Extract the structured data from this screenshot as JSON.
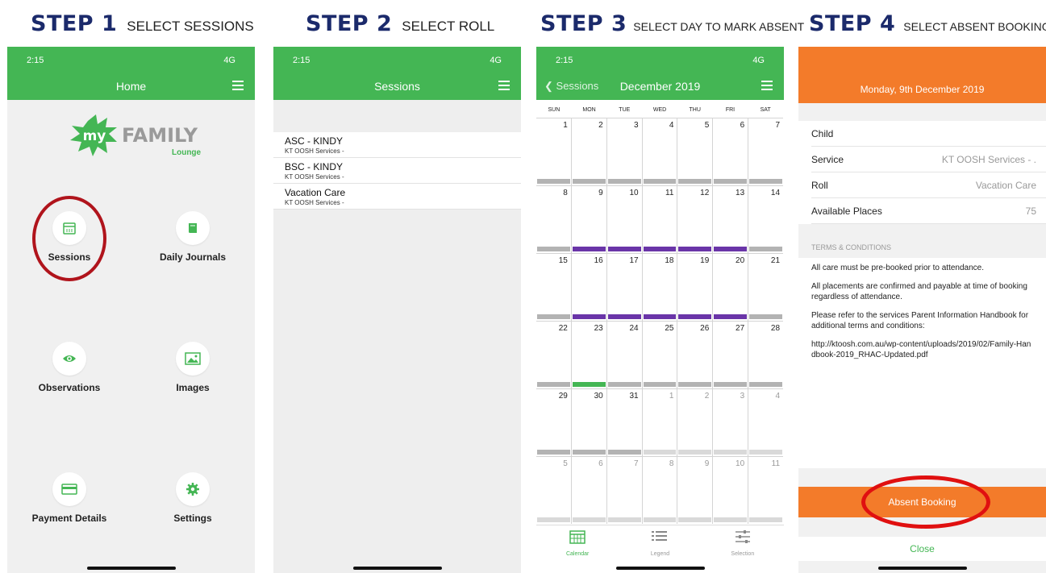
{
  "steps": [
    {
      "big": "STEP 1",
      "small": "SELECT SESSIONS"
    },
    {
      "big": "STEP 2",
      "small": "SELECT ROLL"
    },
    {
      "big": "STEP 3",
      "small": "SELECT DAY TO MARK ABSENT"
    },
    {
      "big": "STEP 4",
      "small": "SELECT ABSENT BOOKING"
    }
  ],
  "status": {
    "time": "2:15",
    "signal": "4G"
  },
  "home": {
    "title": "Home",
    "logo_my": "my",
    "logo_family": "FAMILY",
    "logo_lounge": "Lounge",
    "tiles": [
      {
        "label": "Sessions",
        "icon": "calendar-icon"
      },
      {
        "label": "Daily Journals",
        "icon": "book-icon"
      },
      {
        "label": "Observations",
        "icon": "eye-icon"
      },
      {
        "label": "Images",
        "icon": "image-icon"
      },
      {
        "label": "Payment Details",
        "icon": "card-icon"
      },
      {
        "label": "Settings",
        "icon": "gear-icon"
      }
    ]
  },
  "sessions": {
    "title": "Sessions",
    "items": [
      {
        "name": "ASC - KINDY",
        "sub": "KT OOSH Services -"
      },
      {
        "name": "BSC - KINDY",
        "sub": "KT OOSH Services -"
      },
      {
        "name": "Vacation Care",
        "sub": "KT OOSH Services -"
      }
    ]
  },
  "calendar": {
    "back": "Sessions",
    "month": "December 2019",
    "dow": [
      "SUN",
      "MON",
      "TUE",
      "WED",
      "THU",
      "FRI",
      "SAT"
    ],
    "weeks": [
      {
        "days": [
          "1",
          "2",
          "3",
          "4",
          "5",
          "6",
          "7"
        ],
        "bars": [
          "g",
          "g",
          "g",
          "g",
          "g",
          "g",
          "g"
        ]
      },
      {
        "days": [
          "8",
          "9",
          "10",
          "11",
          "12",
          "13",
          "14"
        ],
        "bars": [
          "g",
          "p",
          "p",
          "p",
          "p",
          "p",
          "g"
        ]
      },
      {
        "days": [
          "15",
          "16",
          "17",
          "18",
          "19",
          "20",
          "21"
        ],
        "bars": [
          "g",
          "p",
          "p",
          "p",
          "p",
          "p",
          "g"
        ]
      },
      {
        "days": [
          "22",
          "23",
          "24",
          "25",
          "26",
          "27",
          "28"
        ],
        "bars": [
          "g",
          "G",
          "g",
          "g",
          "g",
          "g",
          "g"
        ]
      },
      {
        "days": [
          "29",
          "30",
          "31",
          "1",
          "2",
          "3",
          "4"
        ],
        "bars": [
          "g",
          "g",
          "g",
          "l",
          "l",
          "l",
          "l"
        ],
        "dim_from": 3
      },
      {
        "days": [
          "5",
          "6",
          "7",
          "8",
          "9",
          "10",
          "11"
        ],
        "bars": [
          "l",
          "l",
          "l",
          "l",
          "l",
          "l",
          "l"
        ],
        "dim_from": 0
      }
    ],
    "tabs": [
      "Calendar",
      "Legend",
      "Selection"
    ],
    "colors": {
      "grey": "#b3b3b3",
      "purple": "#6a35a8",
      "green": "#44b654",
      "light": "#d9d9d9"
    }
  },
  "booking": {
    "date": "Monday, 9th December 2019",
    "rows": [
      {
        "k": "Child",
        "v": ""
      },
      {
        "k": "Service",
        "v": "KT OOSH Services - ."
      },
      {
        "k": "Roll",
        "v": "Vacation Care"
      },
      {
        "k": "Available Places",
        "v": "75"
      }
    ],
    "tc_head": "TERMS & CONDITIONS",
    "tc": [
      "All care must be pre-booked prior to attendance.",
      "All placements are confirmed and payable at time of booking regardless of attendance.",
      "Please refer to the services Parent Information Handbook for additional terms and conditions:",
      "http://ktoosh.com.au/wp-content/uploads/2019/02/Family-Handbook-2019_RHAC-Updated.pdf"
    ],
    "absent": "Absent Booking",
    "close": "Close"
  },
  "colors": {
    "green": "#44b654",
    "orange": "#f37b2a",
    "navy": "#1b2a6b",
    "red": "#b0141c"
  }
}
